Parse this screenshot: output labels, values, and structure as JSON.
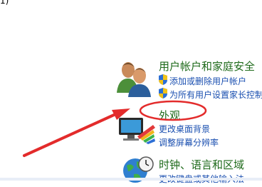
{
  "top_fragment": "1)",
  "categories": [
    {
      "title": "用户帐户和家庭安全",
      "links": [
        "添加或删除用户帐户",
        "为所有用户设置家长控制"
      ]
    },
    {
      "title": "外观",
      "links": [
        "更改桌面背景",
        "调整屏幕分辨率"
      ]
    },
    {
      "title": "时钟、语言和区域",
      "links": [
        "更改键盘或其他输入法"
      ]
    }
  ],
  "icons": {
    "users": "users-icon",
    "appearance": "appearance-icon",
    "clock": "clock-globe-icon",
    "shield": "uac-shield-icon"
  },
  "colors": {
    "category_title": "#1e6a1a",
    "link": "#1a4fb0",
    "annotation": "#e32b2b"
  }
}
